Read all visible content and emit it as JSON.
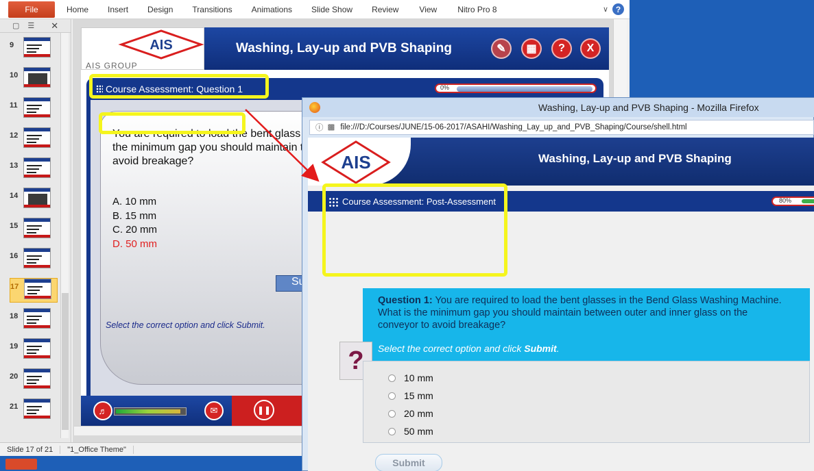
{
  "ppt": {
    "ribbon": {
      "file_tab": "File",
      "tabs": [
        "Home",
        "Insert",
        "Design",
        "Transitions",
        "Animations",
        "Slide Show",
        "Review",
        "View",
        "Nitro Pro 8"
      ]
    },
    "thumbnails": [
      "9",
      "10",
      "11",
      "12",
      "13",
      "14",
      "15",
      "16",
      "17",
      "18",
      "19",
      "20",
      "21"
    ],
    "active_thumbnail": "17",
    "slide": {
      "logo_text": "AIS",
      "logo_group": "AIS GROUP",
      "title": "Washing, Lay-up and PVB Shaping",
      "subheader": "Course Assessment: Question 1",
      "progress": {
        "label": "0%",
        "value": 0
      },
      "question": "You are required to load the bent glass the minimum gap you should maintain to avoid breakage?",
      "options": [
        "A.  10 mm",
        "B.  15 mm",
        "C.  20 mm",
        "D.  50 mm"
      ],
      "correct_option": 3,
      "select_hint": "Select the correct option and click Submit.",
      "submit_stub": "Su"
    },
    "status": {
      "slide": "Slide 17 of 21",
      "theme": "\"1_Office Theme\""
    }
  },
  "firefox": {
    "window_title": "Washing, Lay-up and PVB Shaping - Mozilla Firefox",
    "url": "file:///D:/Courses/JUNE/15-06-2017/ASAHI/Washing_Lay_up_and_PVB_Shaping/Course/shell.html",
    "page": {
      "logo_text": "AIS",
      "title": "Washing, Lay-up and PVB Shaping",
      "subheader": "Course Assessment: Post-Assessment",
      "progress": {
        "label": "80%",
        "value": 80
      },
      "question_label": "Question 1:",
      "question_text": "You are required to load the bent glasses in the Bend Glass Washing Machine. What is the minimum gap you should maintain between outer and inner glass on the conveyor to avoid breakage?",
      "hint_prefix": "Select the correct option and click ",
      "hint_bold": "Submit",
      "hint_suffix": ".",
      "qmark": "?",
      "options": [
        "10 mm",
        "15 mm",
        "20 mm",
        "50 mm"
      ],
      "submit_label": "Submit"
    }
  },
  "colors": {
    "highlight": "#f5f51d",
    "arrow": "#e31b1b",
    "header_blue": "#1d47a3",
    "question_panel": "#17b6ea"
  }
}
